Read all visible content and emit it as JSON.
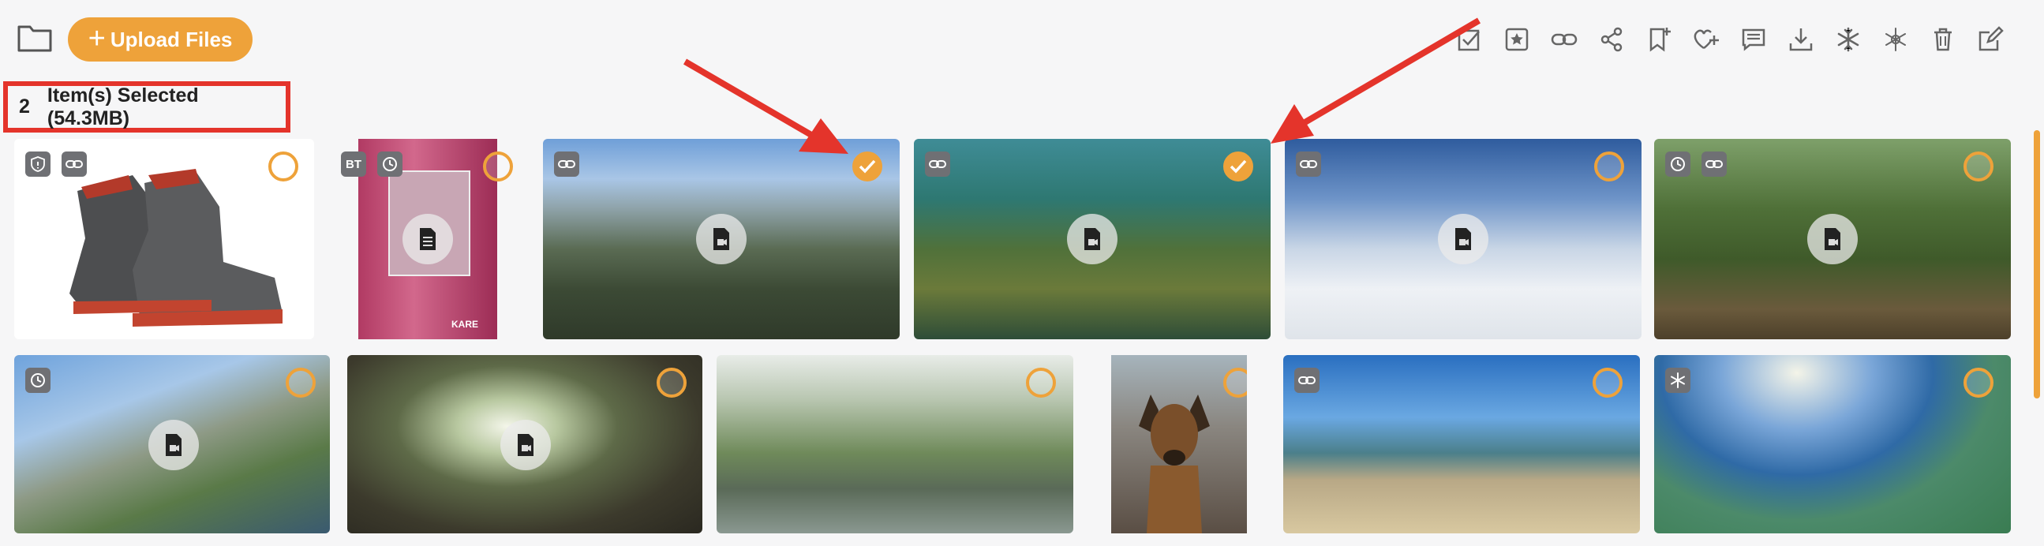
{
  "toolbar": {
    "upload_label": "Upload Files",
    "icons": [
      "select-all-icon",
      "favorite-star-icon",
      "link-icon",
      "share-icon",
      "bookmark-add-icon",
      "heart-add-icon",
      "comment-icon",
      "download-icon",
      "freeze-icon",
      "unfreeze-icon",
      "trash-icon",
      "edit-icon"
    ]
  },
  "selection": {
    "count": "2",
    "text": "Item(s) Selected (54.3MB)"
  },
  "colors": {
    "accent": "#eea23a",
    "highlight": "#e4342b",
    "badge": "#6f7074"
  },
  "badges": {
    "bt": "BT",
    "kare": "KARE"
  },
  "thumbnails": [
    {
      "name": "hiking-boots",
      "selected": false
    },
    {
      "name": "fabric-samples",
      "selected": false
    },
    {
      "name": "aerial-mountain-valley",
      "selected": true
    },
    {
      "name": "underwater-reef",
      "selected": true
    },
    {
      "name": "snow-ski-panorama",
      "selected": false
    },
    {
      "name": "forest-path-panorama",
      "selected": false
    },
    {
      "name": "cliff-lake-view",
      "selected": false
    },
    {
      "name": "cave-panorama",
      "selected": false
    },
    {
      "name": "tree-pond-panorama",
      "selected": false
    },
    {
      "name": "dog-on-deck",
      "selected": false
    },
    {
      "name": "coastal-hill-panorama",
      "selected": false
    },
    {
      "name": "sea-bay-panorama",
      "selected": false
    }
  ]
}
